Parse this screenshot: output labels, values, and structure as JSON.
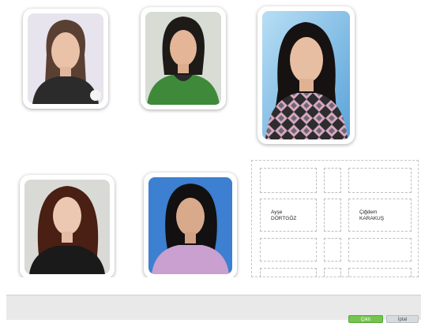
{
  "photos": [
    {
      "id": "photo-1",
      "background": "#e8e4ee",
      "shirt": "#2b2b2b",
      "hair": "#5a4033"
    },
    {
      "id": "photo-2",
      "background": "#d7dcd4",
      "shirt": "#3f8a3a",
      "hair": "#1e1a18"
    },
    {
      "id": "photo-3",
      "background": "#8fc4e6",
      "shirt": "#4b4b4b",
      "hair": "#161212"
    },
    {
      "id": "photo-4",
      "background": "#d9dad5",
      "shirt": "#1a1a1a",
      "hair": "#4a1f14"
    },
    {
      "id": "photo-5",
      "background": "#3d7fd0",
      "shirt": "#c9a0cf",
      "hair": "#121010"
    }
  ],
  "slots": {
    "left_name": "Ayşe\nDÖRTGÖZ",
    "right_name": "Çiğdem\nKARAKUŞ"
  },
  "footer": {
    "primary_label": "Çıktı",
    "secondary_label": "İptal"
  },
  "colors": {
    "primary": "#74c44f",
    "secondary": "#d6dbe0"
  }
}
